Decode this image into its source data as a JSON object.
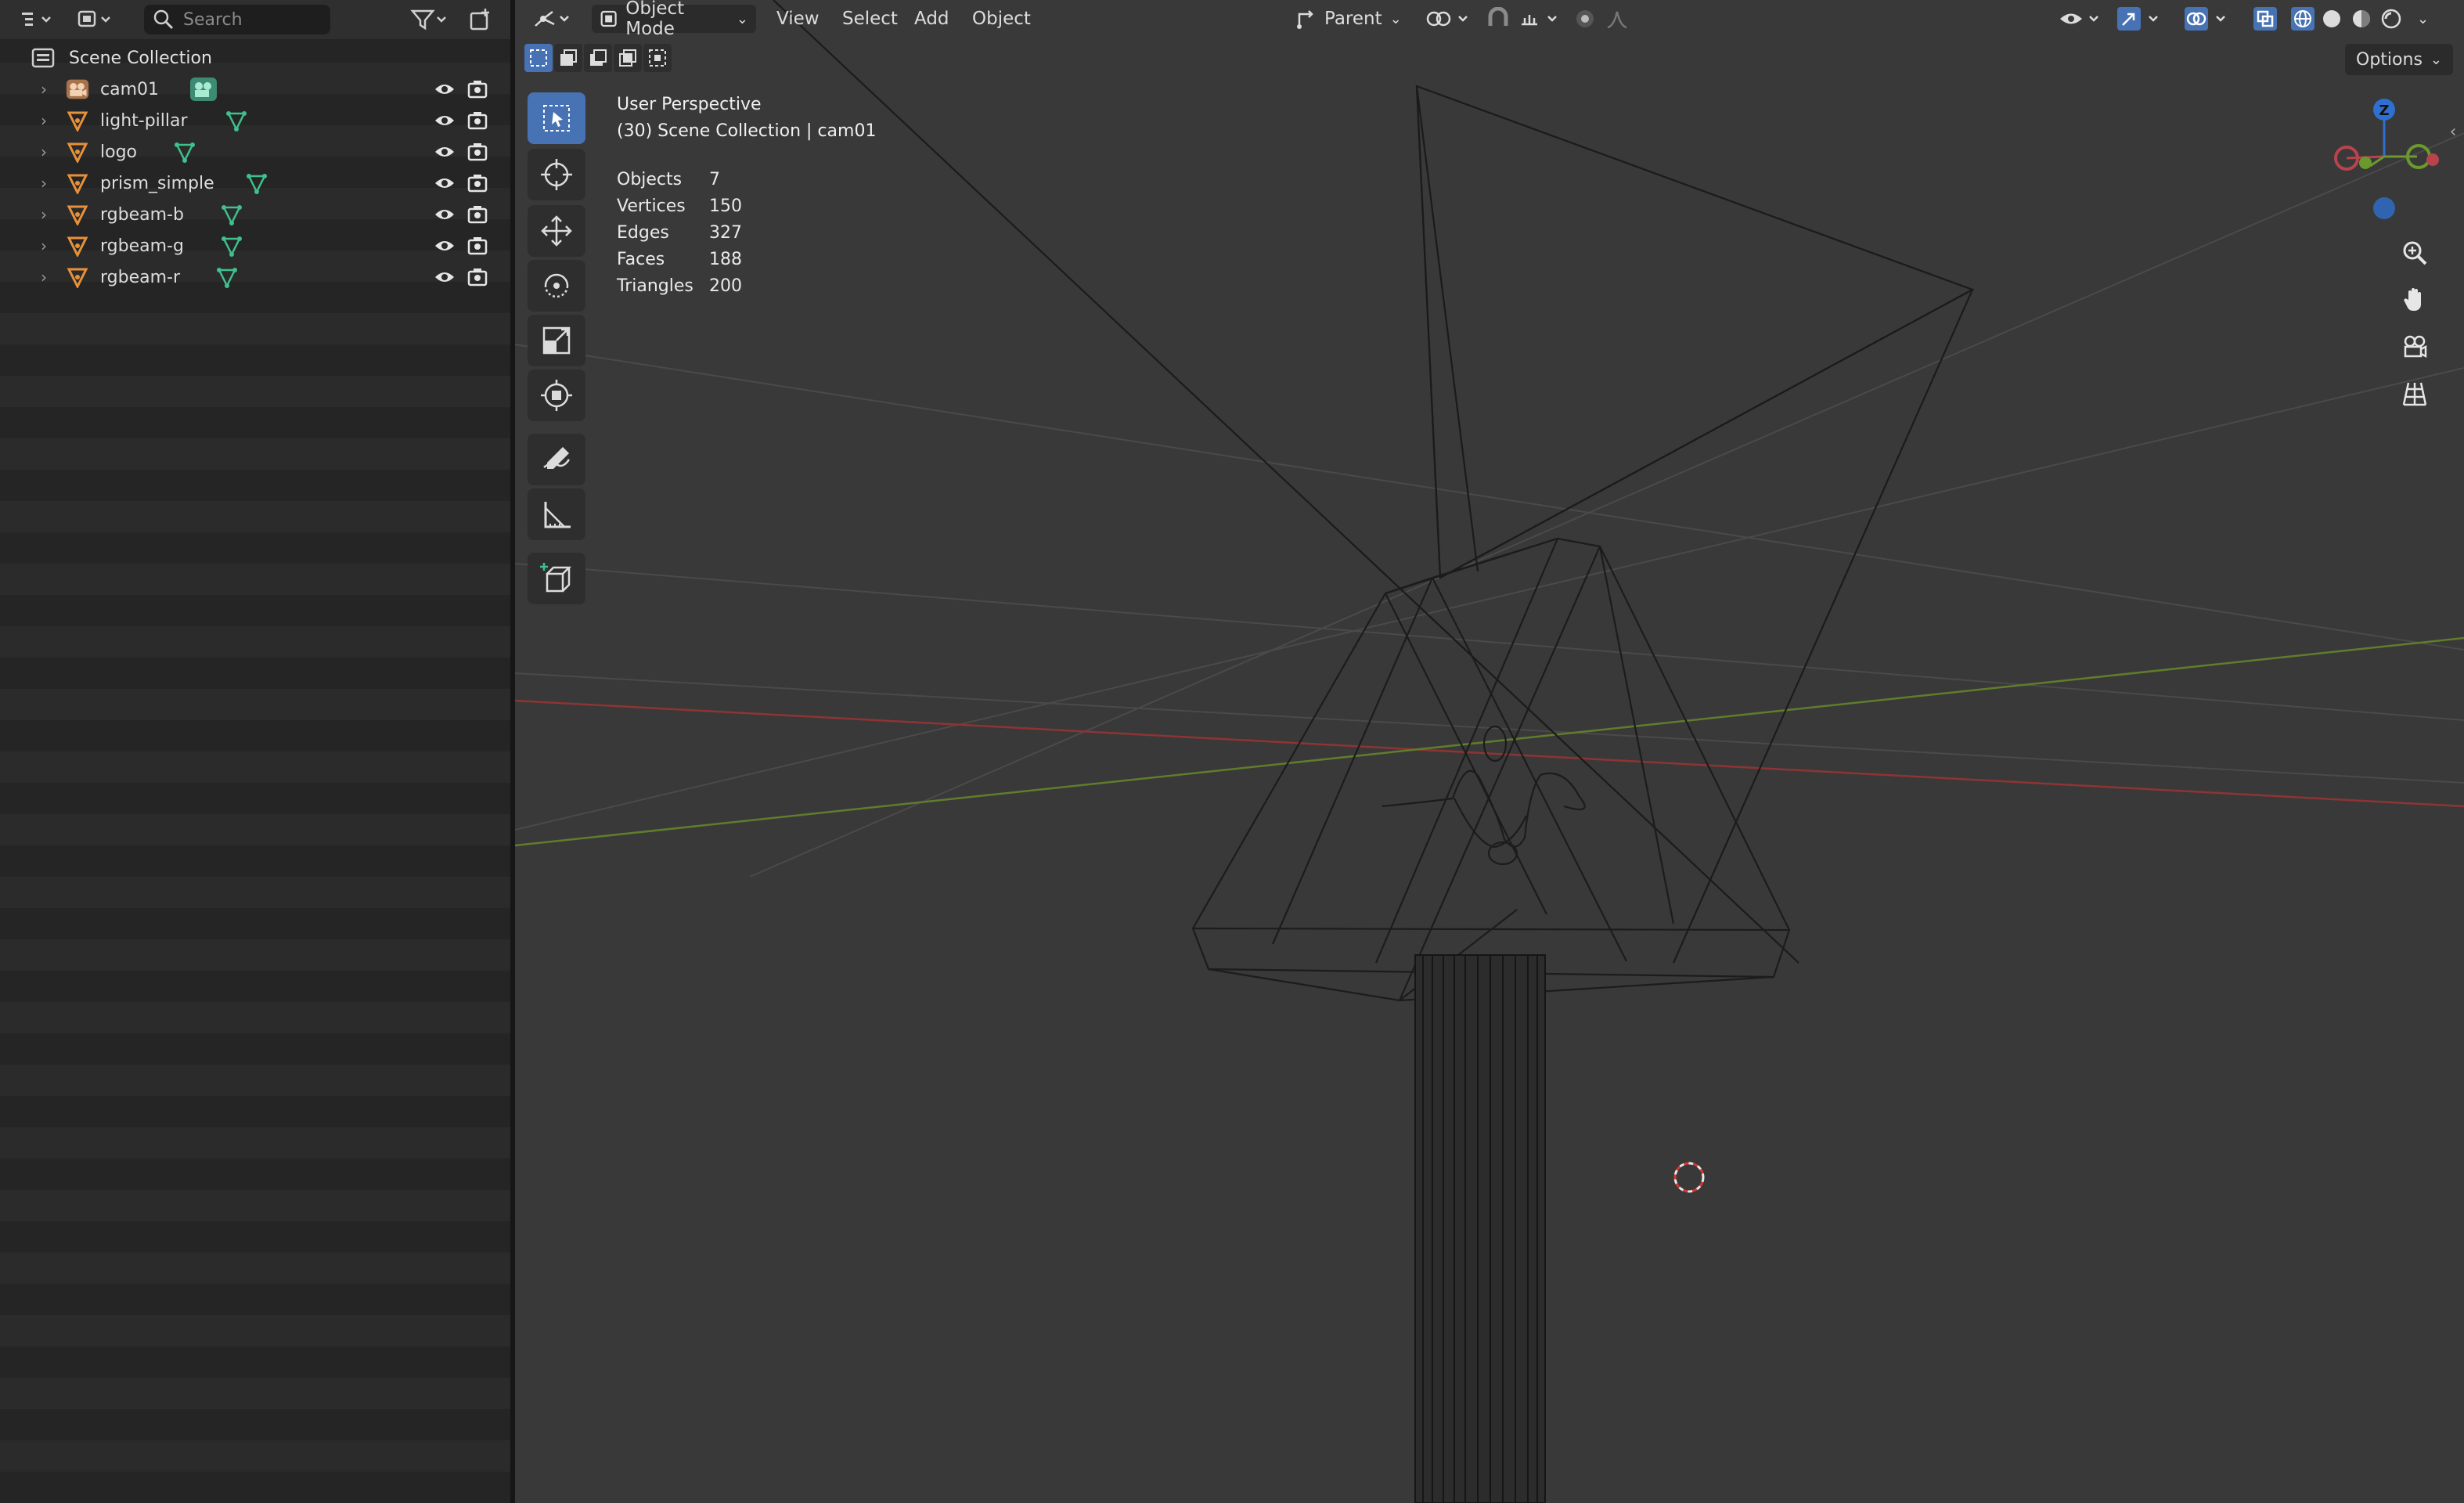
{
  "outliner": {
    "search_placeholder": "Search",
    "scene_label": "Scene Collection",
    "items": [
      {
        "label": "cam01",
        "type": "camera"
      },
      {
        "label": "light-pillar",
        "type": "mesh"
      },
      {
        "label": "logo",
        "type": "mesh"
      },
      {
        "label": "prism_simple",
        "type": "mesh"
      },
      {
        "label": "rgbeam-b",
        "type": "mesh"
      },
      {
        "label": "rgbeam-g",
        "type": "mesh"
      },
      {
        "label": "rgbeam-r",
        "type": "mesh"
      }
    ]
  },
  "viewport": {
    "mode": "Object Mode",
    "menu": [
      "View",
      "Select",
      "Add",
      "Object"
    ],
    "pivot": "Parent",
    "options_label": "Options",
    "view_name": "User Perspective",
    "collection_info": "(30) Scene Collection | cam01",
    "stats": [
      {
        "label": "Objects",
        "value": "7"
      },
      {
        "label": "Vertices",
        "value": "150"
      },
      {
        "label": "Edges",
        "value": "327"
      },
      {
        "label": "Faces",
        "value": "188"
      },
      {
        "label": "Triangles",
        "value": "200"
      }
    ],
    "gizmo_axis_label": "Z"
  },
  "colors": {
    "accent": "#4772b3",
    "mesh_icon": "#e8913a",
    "data_icon": "#3fc08e",
    "x_axis": "#b23a3a",
    "y_axis": "#6a8e2a"
  }
}
